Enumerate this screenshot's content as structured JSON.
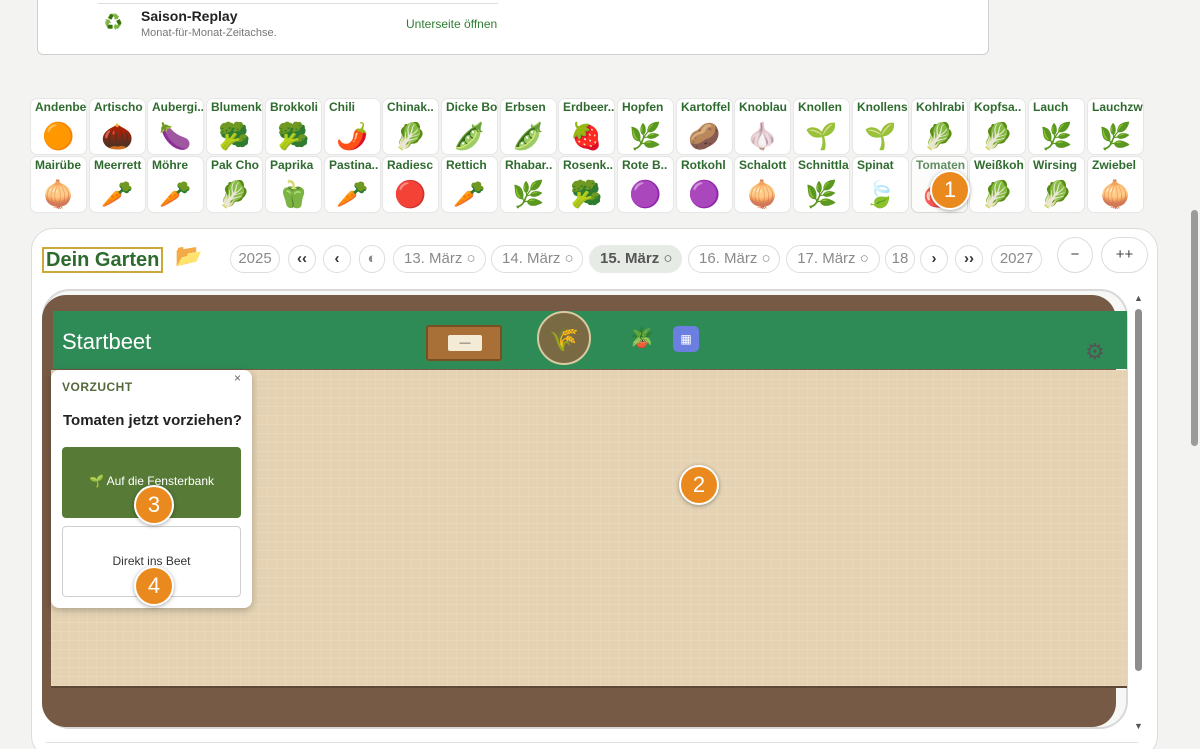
{
  "top_card": {
    "icon": "recycle-icon",
    "title": "Saison-Replay",
    "subtitle": "Monat-für-Monat-Zeitachse.",
    "link": "Unterseite öffnen"
  },
  "plants_row1": [
    {
      "name": "Andenbe",
      "glyph": "🟠"
    },
    {
      "name": "Artischo",
      "glyph": "🌰"
    },
    {
      "name": "Aubergi..",
      "glyph": "🍆"
    },
    {
      "name": "Blumenk",
      "glyph": "🥦"
    },
    {
      "name": "Brokkoli",
      "glyph": "🥦"
    },
    {
      "name": "Chili",
      "glyph": "🌶️"
    },
    {
      "name": "Chinak..",
      "glyph": "🥬"
    },
    {
      "name": "Dicke Bo",
      "glyph": "🫛"
    },
    {
      "name": "Erbsen",
      "glyph": "🫛"
    },
    {
      "name": "Erdbeer..",
      "glyph": "🍓"
    },
    {
      "name": "Hopfen",
      "glyph": "🌿"
    },
    {
      "name": "Kartoffel",
      "glyph": "🥔"
    },
    {
      "name": "Knoblau",
      "glyph": "🧄"
    },
    {
      "name": "Knollen",
      "glyph": "🌱"
    },
    {
      "name": "Knollens",
      "glyph": "🌱"
    },
    {
      "name": "Kohlrabi",
      "glyph": "🥬"
    },
    {
      "name": "Kopfsa..",
      "glyph": "🥬"
    },
    {
      "name": "Lauch",
      "glyph": "🌿"
    },
    {
      "name": "Lauchzw",
      "glyph": "🌿"
    }
  ],
  "plants_row2": [
    {
      "name": "Mairübe",
      "glyph": "🧅"
    },
    {
      "name": "Meerrett",
      "glyph": "🥕"
    },
    {
      "name": "Möhre",
      "glyph": "🥕"
    },
    {
      "name": "Pak Cho",
      "glyph": "🥬"
    },
    {
      "name": "Paprika",
      "glyph": "🫑"
    },
    {
      "name": "Pastina..",
      "glyph": "🥕"
    },
    {
      "name": "Radiesc",
      "glyph": "🔴"
    },
    {
      "name": "Rettich",
      "glyph": "🥕"
    },
    {
      "name": "Rhabar..",
      "glyph": "🌿"
    },
    {
      "name": "Rosenk..",
      "glyph": "🥦"
    },
    {
      "name": "Rote B..",
      "glyph": "🟣"
    },
    {
      "name": "Rotkohl",
      "glyph": "🟣"
    },
    {
      "name": "Schalott",
      "glyph": "🧅"
    },
    {
      "name": "Schnittla",
      "glyph": "🌿"
    },
    {
      "name": "Spinat",
      "glyph": "🍃"
    },
    {
      "name": "Tomaten",
      "glyph": "🍅"
    },
    {
      "name": "Weißkoh",
      "glyph": "🥬"
    },
    {
      "name": "Wirsing",
      "glyph": "🥬"
    },
    {
      "name": "Zwiebel",
      "glyph": "🧅"
    }
  ],
  "garden": {
    "title": "Dein Garten",
    "year_prev": "2025",
    "year_next": "2027",
    "nav_first": "‹‹",
    "nav_prev": "‹",
    "nav_next": "›",
    "nav_last": "››",
    "partial_prev": "◐",
    "dates": [
      "13. März ○",
      "14. März ○",
      "15. März ○",
      "16. März ○",
      "17. März ○"
    ],
    "partial_next": "18",
    "zoom_out": "−",
    "zoom_in": "++"
  },
  "bed": {
    "name": "Startbeet",
    "crate_label": "—"
  },
  "popup": {
    "label": "VORZUCHT",
    "close": "×",
    "question": "Tomaten jetzt vorziehen?",
    "btn_windowsill": "🌱 Auf die Fensterbank",
    "btn_direct": "Direkt ins Beet"
  },
  "markers": [
    "1",
    "2",
    "3",
    "4"
  ],
  "colors": {
    "green": "#2f8b56",
    "accent": "#ea8a1e",
    "soil": "#e4d2b2"
  }
}
